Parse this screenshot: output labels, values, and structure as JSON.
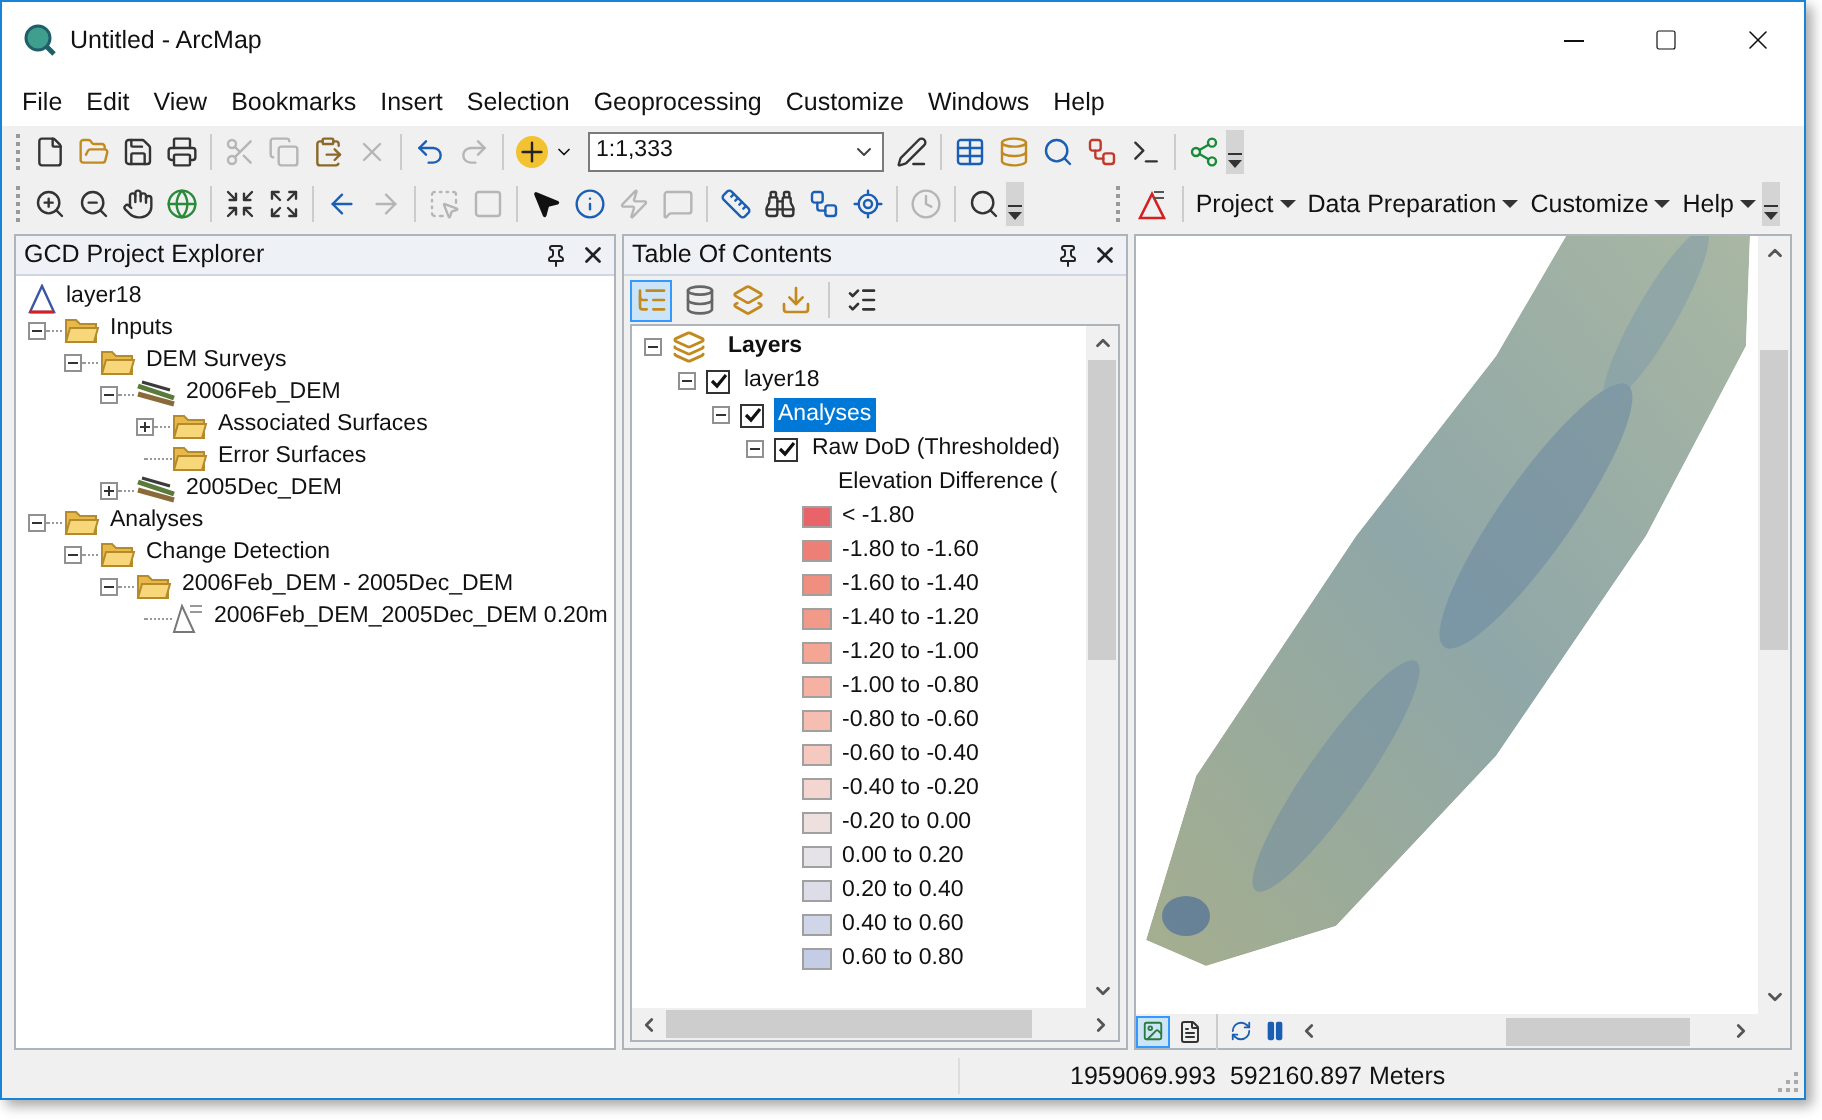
{
  "window": {
    "title": "Untitled - ArcMap"
  },
  "menu": [
    "File",
    "Edit",
    "View",
    "Bookmarks",
    "Insert",
    "Selection",
    "Geoprocessing",
    "Customize",
    "Windows",
    "Help"
  ],
  "scale": {
    "value": "1:1,333"
  },
  "gcd_menu": [
    "Project",
    "Data Preparation",
    "Customize",
    "Help"
  ],
  "explorer": {
    "title": "GCD Project Explorer",
    "tree": [
      {
        "label": "layer18",
        "kind": "raster",
        "children": [
          {
            "label": "Inputs",
            "kind": "folder",
            "expanded": true,
            "children": [
              {
                "label": "DEM Surveys",
                "kind": "folder",
                "expanded": true,
                "children": [
                  {
                    "label": "2006Feb_DEM",
                    "kind": "dem",
                    "expanded": true,
                    "children": [
                      {
                        "label": "Associated Surfaces",
                        "kind": "folder",
                        "expanded": false
                      },
                      {
                        "label": "Error Surfaces",
                        "kind": "folder"
                      }
                    ]
                  },
                  {
                    "label": "2005Dec_DEM",
                    "kind": "dem",
                    "expanded": false
                  }
                ]
              }
            ]
          },
          {
            "label": "Analyses",
            "kind": "folder",
            "expanded": true,
            "children": [
              {
                "label": "Change Detection",
                "kind": "folder",
                "expanded": true,
                "children": [
                  {
                    "label": "2006Feb_DEM - 2005Dec_DEM",
                    "kind": "folder",
                    "expanded": true,
                    "children": [
                      {
                        "label": "2006Feb_DEM_2005Dec_DEM 0.20m",
                        "kind": "dod"
                      }
                    ]
                  }
                ]
              }
            ]
          }
        ]
      }
    ]
  },
  "toc": {
    "title": "Table Of Contents",
    "tabs": [
      {
        "selected": true
      },
      {
        "selected": false
      },
      {
        "selected": false
      },
      {
        "selected": false
      }
    ],
    "tree": [
      {
        "label": "Layers",
        "kind": "frame",
        "expanded": true,
        "children": [
          {
            "label": "layer18",
            "kind": "layer",
            "expanded": true,
            "checked": true,
            "selected": false,
            "children": [
              {
                "label": "Analyses",
                "kind": "layer",
                "expanded": true,
                "checked": true,
                "selected": true,
                "children": [
                  {
                    "label": "Raw DoD (Thresholded)",
                    "kind": "layer",
                    "expanded": true,
                    "checked": true,
                    "selected": false,
                    "legend": {
                      "heading": "Elevation Difference (",
                      "classes": [
                        {
                          "label": "< -1.80",
                          "color": "#e86468"
                        },
                        {
                          "label": "-1.80 to -1.60",
                          "color": "#ee7f76"
                        },
                        {
                          "label": "-1.60 to -1.40",
                          "color": "#f08e80"
                        },
                        {
                          "label": "-1.40 to -1.20",
                          "color": "#f29a89"
                        },
                        {
                          "label": "-1.20 to -1.00",
                          "color": "#f4a594"
                        },
                        {
                          "label": "-1.00 to -0.80",
                          "color": "#f5b1a2"
                        },
                        {
                          "label": "-0.80 to -0.60",
                          "color": "#f6bdb1"
                        },
                        {
                          "label": "-0.60 to -0.40",
                          "color": "#f5c9bf"
                        },
                        {
                          "label": "-0.40 to -0.20",
                          "color": "#f2d6cf"
                        },
                        {
                          "label": "-0.20 to 0.00",
                          "color": "#ede0df"
                        },
                        {
                          "label": "0.00 to 0.20",
                          "color": "#e5e3e8"
                        },
                        {
                          "label": "0.20 to 0.40",
                          "color": "#dcdde9"
                        },
                        {
                          "label": "0.40 to 0.60",
                          "color": "#d1d5e8"
                        },
                        {
                          "label": "0.60 to 0.80",
                          "color": "#c5cce5"
                        }
                      ]
                    }
                  }
                ]
              }
            ]
          }
        ]
      }
    ]
  },
  "status_bar": {
    "coordinates": "1959069.993  592160.897 Meters"
  }
}
